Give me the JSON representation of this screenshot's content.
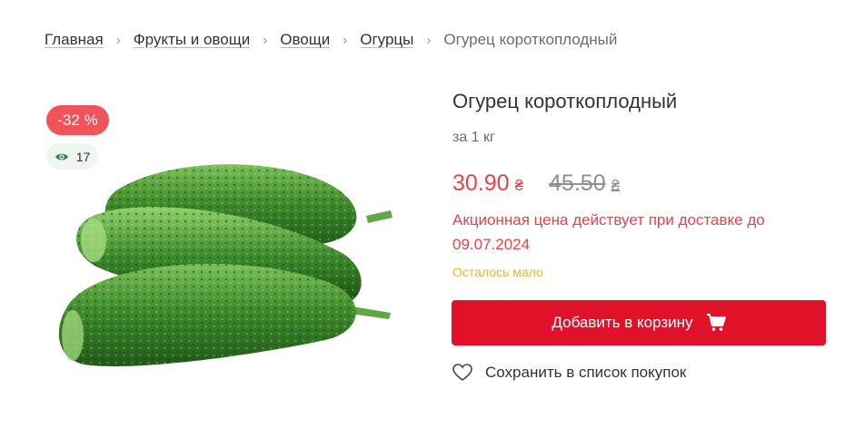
{
  "breadcrumb": {
    "items": [
      "Главная",
      "Фрукты и овощи",
      "Овощи",
      "Огурцы"
    ],
    "current": "Огурец короткоплодный"
  },
  "product": {
    "title": "Огурец короткоплодный",
    "unit": "за 1 кг",
    "price_new": "30.90",
    "price_old": "45.50",
    "currency": "₴",
    "discount_badge": "-32 %",
    "views": "17",
    "promo_note": "Акционная цена действует при доставке до 09.07.2024",
    "stock_note": "Осталось мало",
    "image_icon": "cucumber-image"
  },
  "actions": {
    "add_to_cart_label": "Добавить в корзину",
    "save_label": "Сохранить в список покупок"
  },
  "colors": {
    "accent_red": "#e1112a",
    "price_red": "#e8424b",
    "badge_red": "#f0535a",
    "stock_yellow": "#f0b432",
    "eye_green": "#2e8b3e"
  }
}
